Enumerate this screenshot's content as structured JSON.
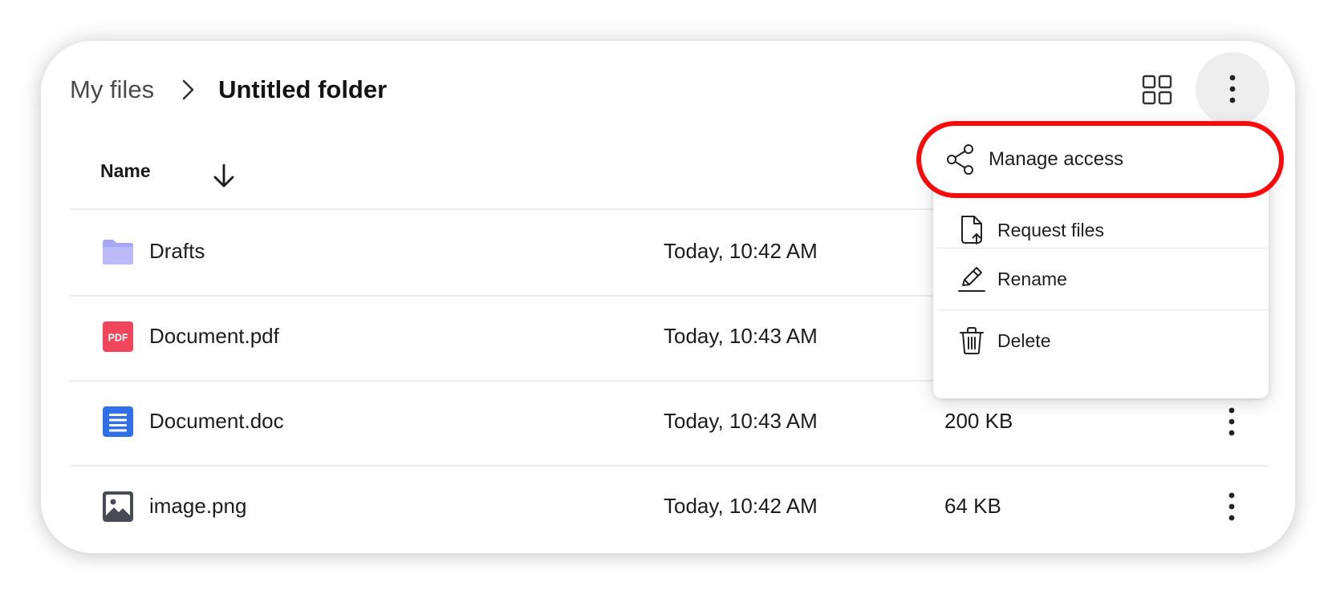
{
  "breadcrumb": {
    "root": "My files",
    "current": "Untitled folder"
  },
  "list": {
    "name_header": "Name",
    "rows": [
      {
        "name": "Drafts",
        "modified": "Today, 10:42 AM",
        "size": "",
        "icon": "folder-icon"
      },
      {
        "name": "Document.pdf",
        "modified": "Today, 10:43 AM",
        "size": "",
        "icon": "pdf-icon",
        "icon_text": "PDF"
      },
      {
        "name": "Document.doc",
        "modified": "Today, 10:43 AM",
        "size": "200 KB",
        "icon": "doc-icon"
      },
      {
        "name": "image.png",
        "modified": "Today, 10:42 AM",
        "size": "64 KB",
        "icon": "image-icon"
      }
    ]
  },
  "menu": {
    "items": [
      {
        "label": "Manage access",
        "icon": "share-icon",
        "highlighted": true
      },
      {
        "label": "Request files",
        "icon": "request-files-icon"
      },
      {
        "label": "Rename",
        "icon": "pencil-icon"
      },
      {
        "label": "Delete",
        "icon": "trash-icon"
      }
    ]
  },
  "colors": {
    "highlight": "#ff0a0a",
    "folder": "#a9a6f5",
    "pdf": "#f0455a",
    "doc": "#2f6fe8",
    "image": "#4a4a55"
  }
}
